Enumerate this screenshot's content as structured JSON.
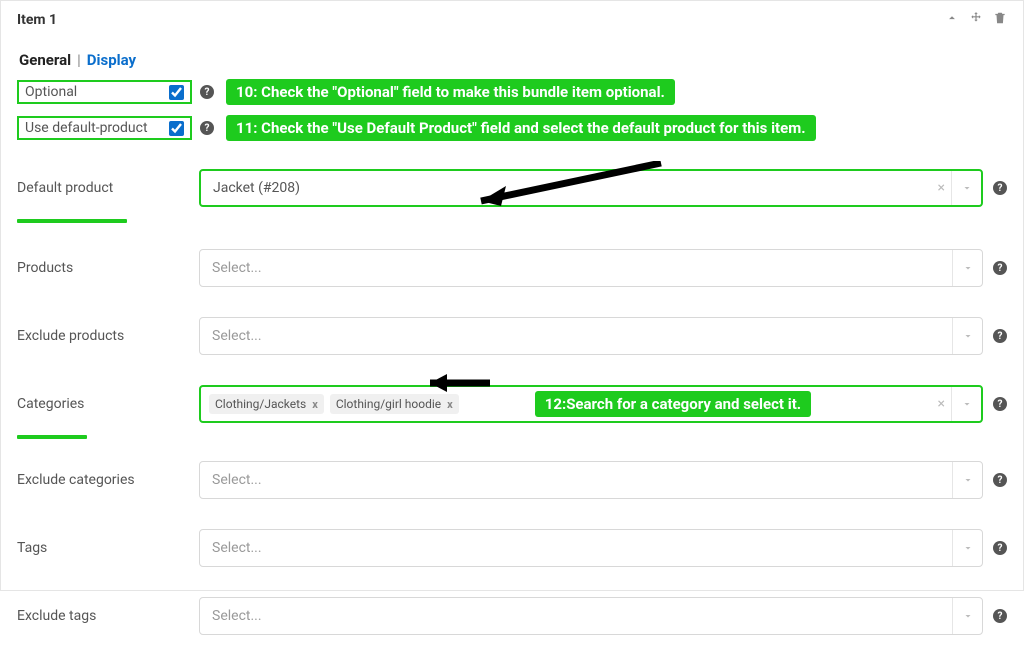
{
  "panel": {
    "title": "Item 1"
  },
  "tabs": {
    "general": "General",
    "display": "Display",
    "sep": "|"
  },
  "checks": {
    "optional": {
      "label": "Optional",
      "checked": true
    },
    "use_default": {
      "label": "Use default-product",
      "checked": true
    }
  },
  "callouts": {
    "c10": "10: Check the \"Optional\" field to make this bundle item optional.",
    "c11": "11: Check the \"Use Default Product\" field and select the default product for this item.",
    "c12": "12:Search for a category and select it."
  },
  "fields": {
    "default_product": {
      "label": "Default product",
      "value": "Jacket (#208)"
    },
    "products": {
      "label": "Products",
      "placeholder": "Select..."
    },
    "exclude_products": {
      "label": "Exclude products",
      "placeholder": "Select..."
    },
    "categories": {
      "label": "Categories",
      "chips": [
        "Clothing/Jackets",
        "Clothing/girl hoodie"
      ]
    },
    "exclude_categories": {
      "label": "Exclude categories",
      "placeholder": "Select..."
    },
    "tags": {
      "label": "Tags",
      "placeholder": "Select..."
    },
    "exclude_tags": {
      "label": "Exclude tags",
      "placeholder": "Select..."
    }
  },
  "glyphs": {
    "help": "?",
    "x": "×",
    "chip_x": "x"
  }
}
